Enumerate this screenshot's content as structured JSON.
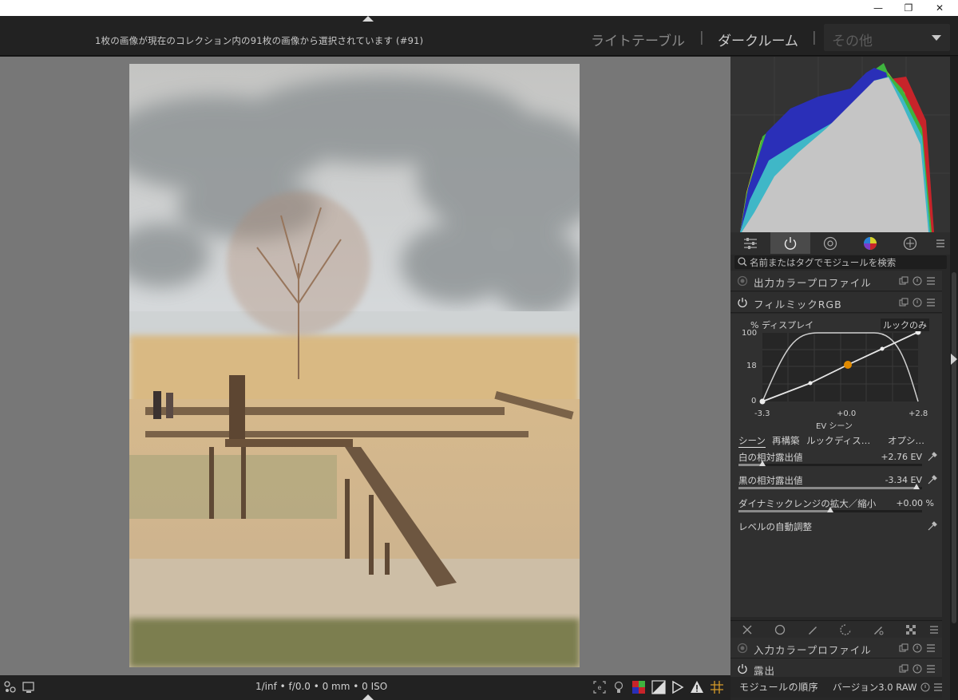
{
  "window": {
    "minimize_glyph": "—",
    "maximize_glyph": "❐",
    "close_glyph": "✕"
  },
  "header": {
    "selection_info": "1枚の画像が現在のコレクション内の91枚の画像から選択されています (#91)",
    "views": {
      "lighttable": "ライトテーブル",
      "separator": "|",
      "darkroom": "ダークルーム",
      "other": "その他"
    }
  },
  "bottom": {
    "exif": "1/inf • f/0.0 • 0 mm • 0 ISO",
    "icons": [
      "focus-peaking-icon",
      "color-assessment-icon",
      "softproof-icon",
      "gamut-check-icon",
      "overexposed-icon",
      "raw-overexposed-icon",
      "guides-icon"
    ]
  },
  "right_panel": {
    "search_placeholder": "名前またはタグでモジュールを検索",
    "tabs": [
      "quick-access-icon",
      "active-modules-icon",
      "base-modules-icon",
      "color-modules-icon",
      "correct-modules-icon",
      "presets-menu-icon"
    ],
    "modules": {
      "output_profile": "出力カラープロファイル",
      "filmic": "フィルミックRGB",
      "input_profile": "入力カラープロファイル",
      "exposure": "露出"
    },
    "filmic": {
      "graph": {
        "y_title": "% ディスプレイ",
        "look_badge": "ルックのみ",
        "y_ticks": [
          "100",
          "18",
          "0"
        ],
        "x_ticks": [
          "-3.3",
          "+0.0",
          "+2.8"
        ],
        "x_title": "EV  シーン"
      },
      "subtabs": [
        "シーン",
        "再構築",
        "ルック",
        "ディス…",
        "オプシ…"
      ],
      "params": [
        {
          "label": "白の相対露出値",
          "value": "+2.76 EV",
          "position": 0.13
        },
        {
          "label": "黒の相対露出値",
          "value": "-3.34 EV",
          "position": 0.97
        },
        {
          "label": "ダイナミックレンジの拡大／縮小",
          "value": "+0.00 %",
          "position": 0.5
        },
        {
          "label": "レベルの自動調整",
          "value": "",
          "position": null
        }
      ]
    },
    "footer": {
      "label": "モジュールの順序",
      "value": "バージョン3.0 RAW"
    }
  },
  "colors": {
    "accent_point": "#e08a00",
    "histogram_blue": "#2a2fb8",
    "histogram_cyan": "#3fb7c7",
    "histogram_red": "#c8242a",
    "histogram_yellow": "#d8d12a",
    "histogram_green": "#3fb43f"
  }
}
